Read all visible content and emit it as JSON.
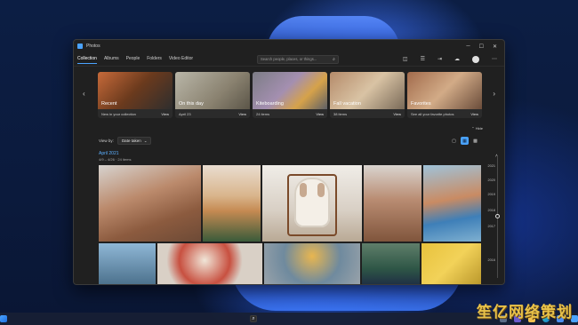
{
  "window": {
    "title": "Photos",
    "caption": {
      "minimize": "─",
      "maximize": "☐",
      "close": "✕"
    }
  },
  "nav": {
    "tabs": [
      {
        "label": "Collection",
        "active": true
      },
      {
        "label": "Albums"
      },
      {
        "label": "People"
      },
      {
        "label": "Folders"
      },
      {
        "label": "Video Editor"
      }
    ],
    "search": {
      "placeholder": "Search people, places, or things..."
    },
    "actions": [
      "camera-icon",
      "select-icon",
      "import-icon",
      "cloud-icon",
      "avatar",
      "more-icon"
    ]
  },
  "memories": [
    {
      "caption": "Recent",
      "meta": "New in your collection",
      "view": "View"
    },
    {
      "caption": "On this day",
      "meta": "April 23",
      "view": "View"
    },
    {
      "caption": "Kiteboarding",
      "meta": "24 items",
      "view": "View"
    },
    {
      "caption": "Fall vacation",
      "meta": "38 items",
      "view": "View"
    },
    {
      "caption": "Favorites",
      "meta": "See all your favorite photos",
      "view": "View"
    }
  ],
  "hide_label": "Hide",
  "view_by": {
    "label": "View by:",
    "value": "Date taken"
  },
  "date_group": {
    "month": "April 2021",
    "range": "4/9 – 4/26  ·  24 items"
  },
  "timeline": [
    "2021",
    "2020",
    "2019",
    "2018",
    "2017",
    "2016"
  ],
  "watermark": "笙亿网络策划",
  "colors": {
    "accent": "#4aa3ff",
    "window_bg": "#202020"
  }
}
